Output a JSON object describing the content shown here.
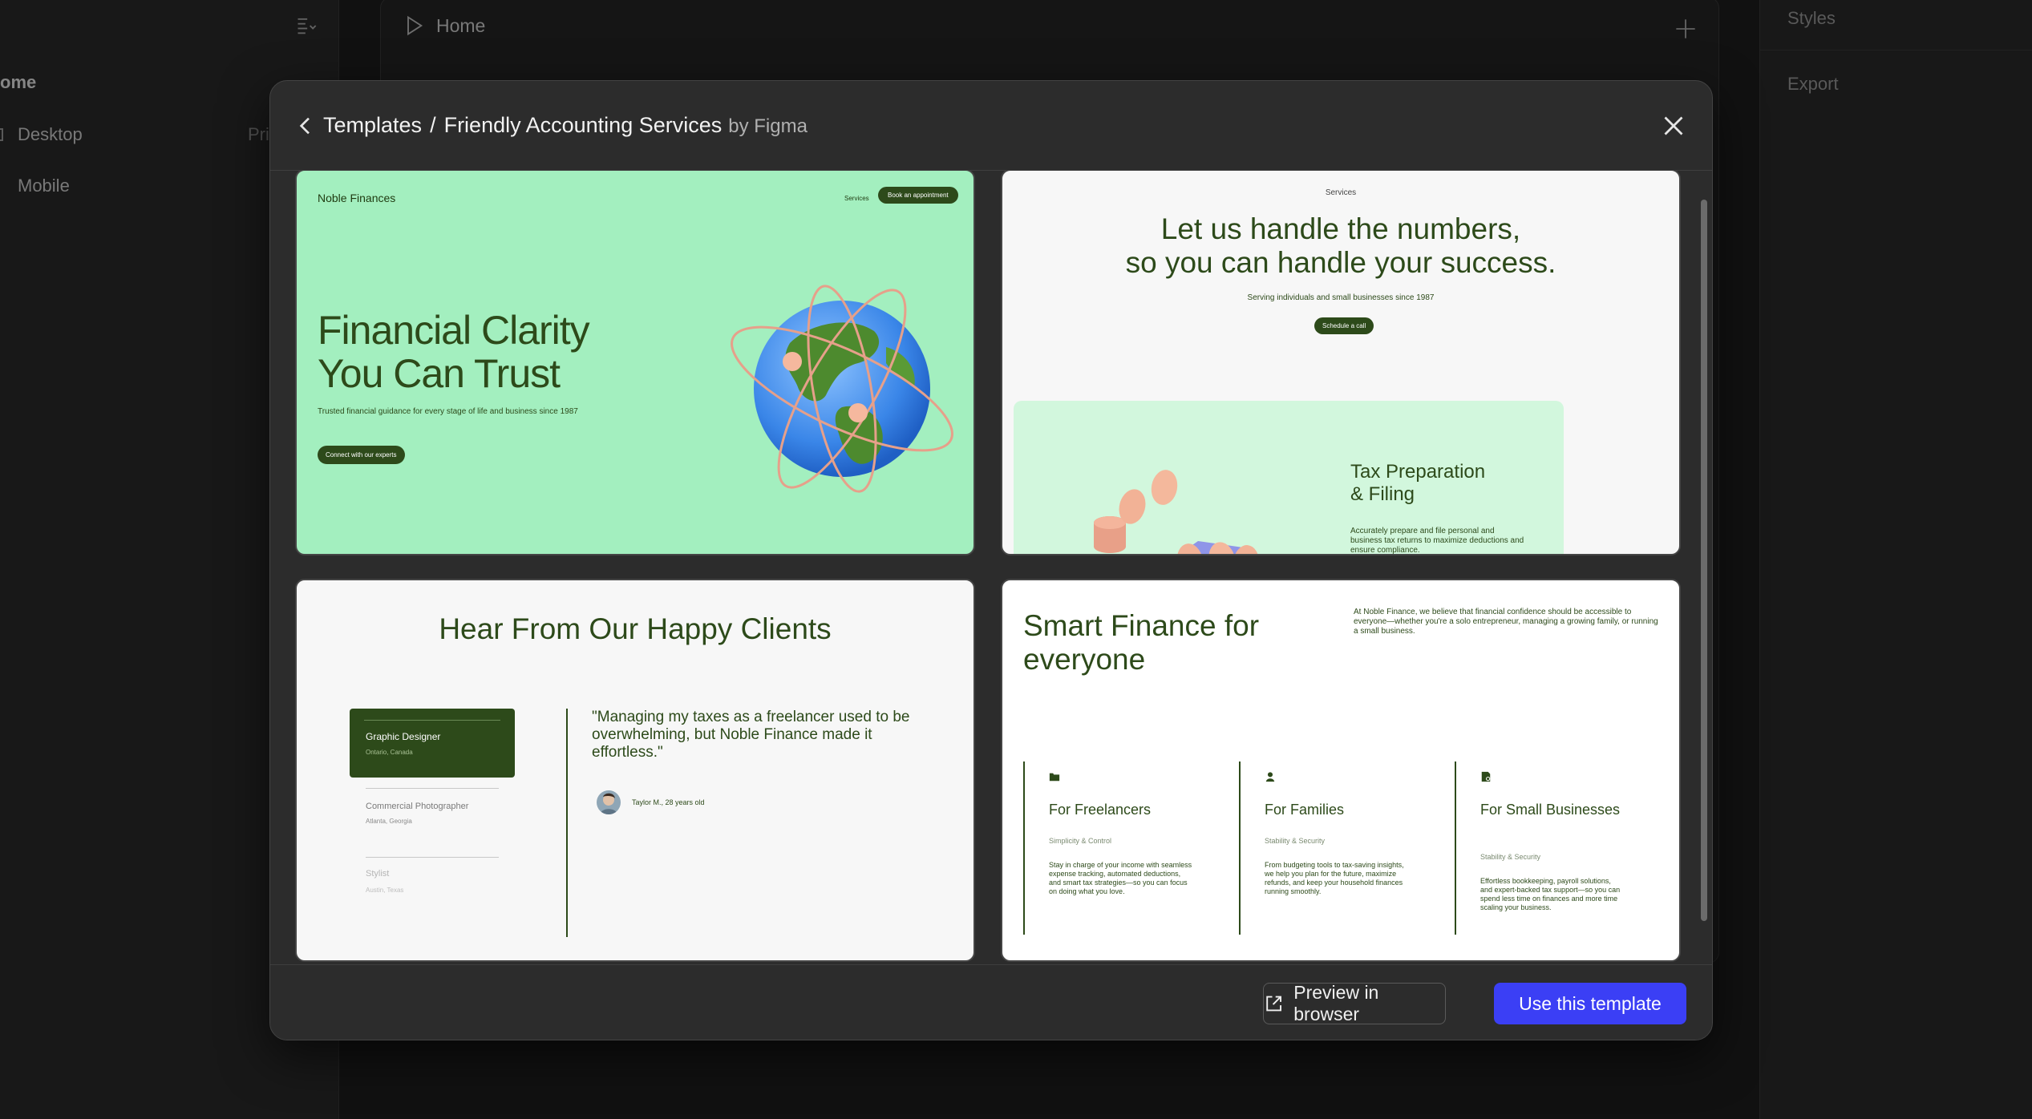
{
  "background": {
    "left_panel": {
      "section_title": "ome",
      "pages": [
        {
          "label": "Desktop",
          "tag": "Pri"
        },
        {
          "label": "Mobile"
        }
      ]
    },
    "canvas": {
      "frame_title": "Home"
    },
    "right_panel": {
      "styles_label": "Styles",
      "export_label": "Export"
    }
  },
  "modal": {
    "breadcrumb_root": "Templates",
    "breadcrumb_separator": "/",
    "template_name": "Friendly Accounting Services",
    "byline": "by Figma",
    "footer": {
      "preview_label": "Preview in browser",
      "use_label": "Use this template"
    }
  },
  "previews": {
    "card1": {
      "brand": "Noble Finances",
      "nav_link": "Services",
      "nav_button": "Book an appointment",
      "headline_line1": "Financial Clarity",
      "headline_line2": "You Can Trust",
      "subtext": "Trusted financial guidance for every stage of life and business since 1987",
      "cta": "Connect with our experts"
    },
    "card2": {
      "nav_link": "Services",
      "headline_line1": "Let us handle the numbers,",
      "headline_line2": "so you can handle your success.",
      "subtext": "Serving individuals and small businesses since 1987",
      "cta": "Schedule a call",
      "panel_title_line1": "Tax Preparation",
      "panel_title_line2": "& Filing",
      "panel_text": "Accurately prepare and file personal and business tax returns to maximize deductions and ensure compliance."
    },
    "card3": {
      "title": "Hear From Our Happy Clients",
      "active_role": "Graphic Designer",
      "active_location": "Ontario, Canada",
      "items": [
        {
          "role": "Commercial Photographer",
          "location": "Atlanta, Georgia"
        },
        {
          "role": "Stylist",
          "location": "Austin, Texas"
        }
      ],
      "quote": "\"Managing my taxes as a freelancer used to be overwhelming, but Noble Finance made it effortless.\"",
      "author": "Taylor M., 28 years old"
    },
    "card4": {
      "title_line1": "Smart Finance for",
      "title_line2": "everyone",
      "intro": "At Noble Finance, we believe that financial confidence should be accessible to everyone—whether you're a solo entrepreneur, managing a growing family, or running a small business.",
      "columns": [
        {
          "icon": "folder-icon",
          "heading": "For Freelancers",
          "tagline": "Simplicity & Control",
          "text": "Stay in charge of your income with seamless expense tracking, automated deductions, and smart tax strategies—so you can focus on doing what you love."
        },
        {
          "icon": "person-icon",
          "heading": "For Families",
          "tagline": "Stability & Security",
          "text": "From budgeting tools to tax-saving insights, we help you plan for the future, maximize refunds, and keep your household finances running smoothly."
        },
        {
          "icon": "document-icon",
          "heading": "For Small Businesses",
          "tagline": "Stability & Security",
          "text": "Effortless bookkeeping, payroll solutions, and expert-backed tax support—so you can spend less time on finances and more time scaling your business."
        }
      ]
    }
  },
  "colors": {
    "accent": "#3b3ff5",
    "preview_green": "#a3efbf",
    "dark_green": "#2d4a1a",
    "modal_bg": "#2c2c2c"
  }
}
